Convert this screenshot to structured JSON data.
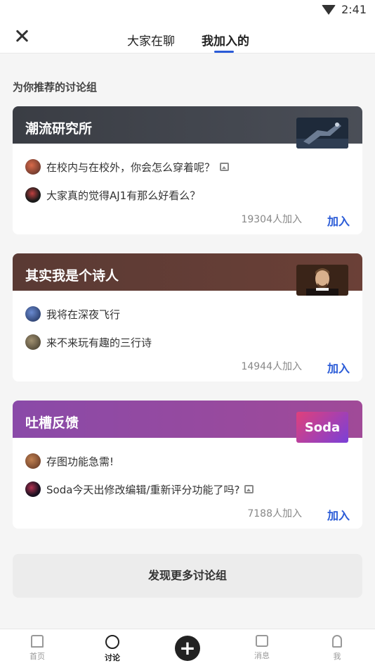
{
  "status_bar": {
    "time": "2:41",
    "icon": "wifi-icon"
  },
  "header": {
    "tabs": [
      {
        "label": "大家在聊"
      },
      {
        "label": "我加入的",
        "active": true
      }
    ],
    "accent": "#2a5bd7"
  },
  "section_title": "为你推荐的讨论组",
  "groups": [
    {
      "name": "潮流研究所",
      "header_color": "#3a3d44",
      "posts": [
        {
          "text": "在校内与在校外，你会怎么穿着呢？",
          "has_image": true
        },
        {
          "text": "大家真的觉得AJ1有那么好看么？",
          "has_image": false
        }
      ],
      "members": "19304人加入",
      "join_label": "加入"
    },
    {
      "name": "其实我是个诗人",
      "header_color": "#5a3a34",
      "posts": [
        {
          "text": "我将在深夜飞行",
          "has_image": false
        },
        {
          "text": "来不来玩有趣的三行诗",
          "has_image": false
        }
      ],
      "members": "14944人加入",
      "join_label": "加入"
    },
    {
      "name": "吐槽反馈",
      "header_color": "#8a4aa8",
      "thumb_text": "Soda",
      "posts": [
        {
          "text": "存图功能急需!",
          "has_image": false
        },
        {
          "text": "Soda今天出修改编辑/重新评分功能了吗?",
          "has_image": true
        }
      ],
      "members": "7188人加入",
      "join_label": "加入"
    }
  ],
  "discover_label": "发现更多讨论组",
  "bottom_nav": [
    {
      "label": "首页",
      "icon": "home-icon"
    },
    {
      "label": "讨论",
      "icon": "discussion-icon",
      "active": true
    },
    {
      "label": "",
      "icon": "plus-icon"
    },
    {
      "label": "消息",
      "icon": "message-icon"
    },
    {
      "label": "我",
      "icon": "profile-icon"
    }
  ]
}
